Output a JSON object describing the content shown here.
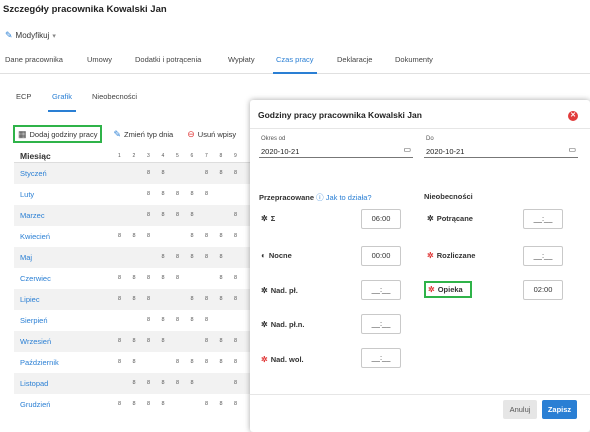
{
  "page": {
    "title": "Szczegóły pracownika Kowalski Jan"
  },
  "modify": {
    "label": "Modyfikuj"
  },
  "main_tabs": [
    {
      "label": "Dane pracownika"
    },
    {
      "label": "Umowy"
    },
    {
      "label": "Dodatki i potrącenia"
    },
    {
      "label": "Wypłaty"
    },
    {
      "label": "Czas pracy",
      "active": true
    },
    {
      "label": "Deklaracje"
    },
    {
      "label": "Dokumenty"
    }
  ],
  "sub_tabs": [
    {
      "label": "ECP"
    },
    {
      "label": "Grafik",
      "active": true
    },
    {
      "label": "Nieobecności"
    }
  ],
  "toolbar": {
    "add_label": "Dodaj godziny pracy",
    "change_label": "Zmień typ dnia",
    "delete_label": "Usuń wpisy"
  },
  "grid": {
    "month_header": "Miesiąc",
    "days": [
      "1",
      "2",
      "3",
      "4",
      "5",
      "6",
      "7",
      "8",
      "9"
    ],
    "rows": [
      {
        "month": "Styczeń",
        "hours": [
          "",
          "",
          "8",
          "8",
          "",
          "",
          "8",
          "8",
          "8"
        ]
      },
      {
        "month": "Luty",
        "hours": [
          "",
          "",
          "8",
          "8",
          "8",
          "8",
          "8",
          "",
          ""
        ]
      },
      {
        "month": "Marzec",
        "hours": [
          "",
          "",
          "8",
          "8",
          "8",
          "8",
          "",
          "",
          "8"
        ]
      },
      {
        "month": "Kwiecień",
        "hours": [
          "8",
          "8",
          "8",
          "",
          "",
          "8",
          "8",
          "8",
          "8"
        ]
      },
      {
        "month": "Maj",
        "hours": [
          "",
          "",
          "",
          "8",
          "8",
          "8",
          "8",
          "8",
          ""
        ]
      },
      {
        "month": "Czerwiec",
        "hours": [
          "8",
          "8",
          "8",
          "8",
          "8",
          "",
          "",
          "8",
          "8"
        ]
      },
      {
        "month": "Lipiec",
        "hours": [
          "8",
          "8",
          "8",
          "",
          "",
          "8",
          "8",
          "8",
          "8"
        ]
      },
      {
        "month": "Sierpień",
        "hours": [
          "",
          "",
          "8",
          "8",
          "8",
          "8",
          "8",
          "",
          ""
        ]
      },
      {
        "month": "Wrzesień",
        "hours": [
          "8",
          "8",
          "8",
          "8",
          "",
          "",
          "8",
          "8",
          "8"
        ]
      },
      {
        "month": "Październik",
        "hours": [
          "8",
          "8",
          "",
          "",
          "8",
          "8",
          "8",
          "8",
          "8"
        ]
      },
      {
        "month": "Listopad",
        "hours": [
          "",
          "8",
          "8",
          "8",
          "8",
          "8",
          "",
          "",
          "8"
        ]
      },
      {
        "month": "Grudzień",
        "hours": [
          "8",
          "8",
          "8",
          "8",
          "",
          "",
          "8",
          "8",
          "8"
        ]
      }
    ]
  },
  "modal": {
    "title": "Godziny pracy pracownika Kowalski Jan",
    "date_from": {
      "label": "Okres od",
      "value": "2020-10-21"
    },
    "date_to": {
      "label": "Do",
      "value": "2020-10-21"
    },
    "worked_section": "Przepracowane",
    "help_link": "Jak to działa?",
    "absence_section": "Nieobecności",
    "fields": {
      "sum": {
        "label": "Σ",
        "value": "06:00"
      },
      "night": {
        "label": "Nocne",
        "value": "00:00"
      },
      "overtime": {
        "label": "Nad. pł.",
        "value": "__:__"
      },
      "overtime_half": {
        "label": "Nad. pł.n.",
        "value": "__:__"
      },
      "overtime_free": {
        "label": "Nad. wol.",
        "value": "__:__"
      },
      "deducted": {
        "label": "Potrącane",
        "value": "__:__"
      },
      "settled": {
        "label": "Rozliczane",
        "value": "__:__"
      },
      "care": {
        "label": "Opieka",
        "value": "02:00"
      }
    },
    "cancel_label": "Anuluj",
    "save_label": "Zapisz"
  },
  "colors": {
    "accent": "#2a7fd4",
    "highlight": "#2fb349",
    "danger": "#e13b3b"
  }
}
